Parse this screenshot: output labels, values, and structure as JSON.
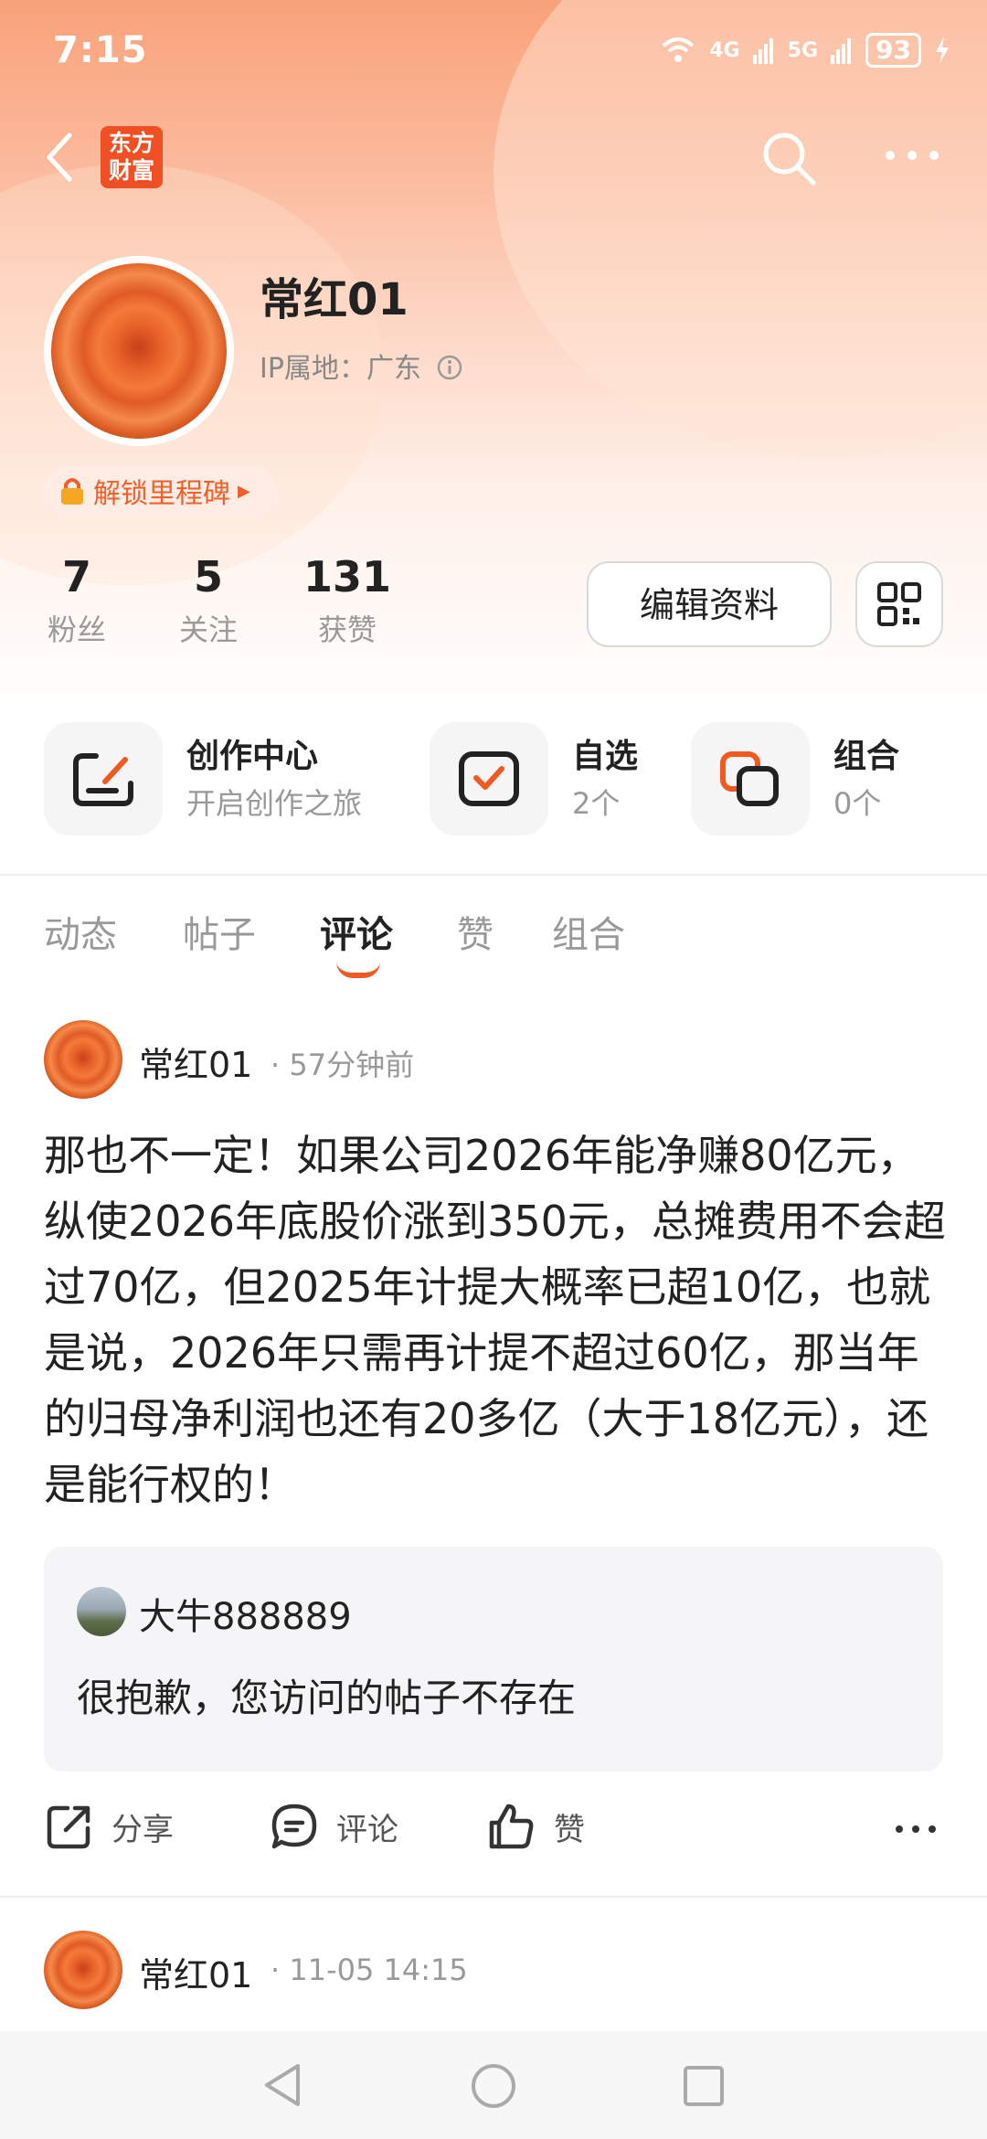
{
  "status_bar": {
    "time": "7:15",
    "net1": "4G",
    "net2": "5G",
    "battery": "93"
  },
  "header": {
    "logo_line1": "东方",
    "logo_line2": "财富"
  },
  "profile": {
    "name": "常红01",
    "ip_location": "IP属地：广东",
    "milestone": "解锁里程碑",
    "stats": [
      {
        "value": "7",
        "label": "粉丝"
      },
      {
        "value": "5",
        "label": "关注"
      },
      {
        "value": "131",
        "label": "获赞"
      }
    ],
    "edit_button": "编辑资料"
  },
  "tools": [
    {
      "title": "创作中心",
      "subtitle": "开启创作之旅",
      "icon": "edit-icon"
    },
    {
      "title": "自选",
      "subtitle": "2个",
      "icon": "check-icon"
    },
    {
      "title": "组合",
      "subtitle": "0个",
      "icon": "portfolio-icon"
    }
  ],
  "tabs": [
    "动态",
    "帖子",
    "评论",
    "赞",
    "组合"
  ],
  "active_tab": "评论",
  "posts": [
    {
      "author": "常红01",
      "time": "57分钟前",
      "content": "那也不一定！如果公司2026年能净赚80亿元，纵使2026年底股价涨到350元，总摊费用不会超过70亿，但2025年计提大概率已超10亿，也就是说，2026年只需再计提不超过60亿，那当年的归母净利润也还有20多亿（大于18亿元），还是能行权的！",
      "quote": {
        "author": "大牛888889",
        "text": "很抱歉，您访问的帖子不存在"
      },
      "actions": {
        "share": "分享",
        "comment": "评论",
        "like": "赞"
      }
    },
    {
      "author": "常红01",
      "time": "11-05 14:15"
    }
  ],
  "colors": {
    "accent": "#f05a22",
    "header_gradient_top": "#f9a27a"
  }
}
